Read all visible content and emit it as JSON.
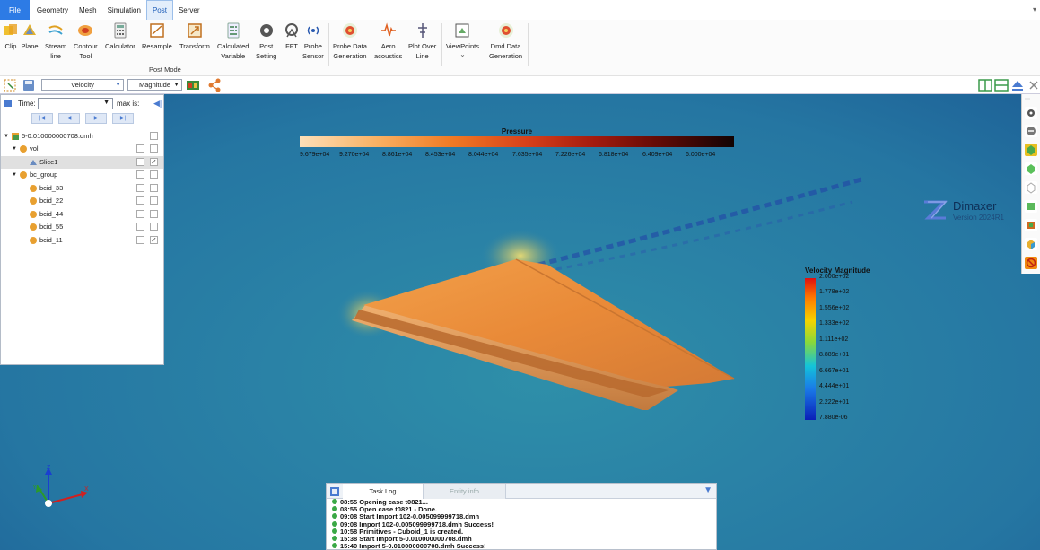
{
  "menu": {
    "items": [
      "File",
      "Geometry",
      "Mesh",
      "Simulation",
      "Post",
      "Server"
    ],
    "active": "Post"
  },
  "ribbon": {
    "buttons": [
      {
        "label": "Clip",
        "icon": "clip-icon"
      },
      {
        "label": "Plane",
        "icon": "plane-icon"
      },
      {
        "label": "Stream\nline",
        "icon": "streamline-icon"
      },
      {
        "label": "Contour\nTool",
        "icon": "contour-icon"
      },
      {
        "label": "Calculator",
        "icon": "calculator-icon"
      },
      {
        "label": "Resample",
        "icon": "resample-icon"
      },
      {
        "label": "Transform",
        "icon": "transform-icon"
      },
      {
        "label": "Calculated\nVariable",
        "icon": "calculated-variable-icon"
      },
      {
        "label": "Post\nSetting",
        "icon": "gear-icon"
      },
      {
        "label": "FFT",
        "icon": "fft-icon"
      },
      {
        "label": "Probe\nSensor",
        "icon": "probe-icon"
      },
      {
        "label": "Probe Data\nGeneration",
        "icon": "probe-data-icon"
      },
      {
        "label": "Aero\nacoustics",
        "icon": "aeroacoustics-icon"
      },
      {
        "label": "Plot Over\nLine",
        "icon": "plot-over-line-icon"
      },
      {
        "label": "ViewPoints",
        "icon": "viewpoints-icon"
      },
      {
        "label": "Dmd Data\nGeneration",
        "icon": "dmd-icon"
      }
    ],
    "group_label": "Post Mode"
  },
  "toolbar": {
    "variable": "Velocity",
    "component": "Magnitude"
  },
  "tree": {
    "time_label": "Time:",
    "time_value": "",
    "max_label": "max is:",
    "nodes": [
      {
        "label": "5-0.010000000708.dmh",
        "checked": false
      },
      {
        "label": "vol",
        "checked": false
      },
      {
        "label": "Slice1",
        "checked": true
      },
      {
        "label": "bc_group",
        "checked": false
      },
      {
        "label": "bcid_33",
        "checked": false
      },
      {
        "label": "bcid_22",
        "checked": false
      },
      {
        "label": "bcid_44",
        "checked": false
      },
      {
        "label": "bcid_55",
        "checked": false
      },
      {
        "label": "bcid_11",
        "checked": true
      }
    ]
  },
  "pressure_bar": {
    "title": "Pressure",
    "ticks": [
      "9.679e+04",
      "9.270e+04",
      "8.861e+04",
      "8.453e+04",
      "8.044e+04",
      "7.635e+04",
      "7.226e+04",
      "6.818e+04",
      "6.409e+04",
      "6.000e+04"
    ]
  },
  "velocity_bar": {
    "title": "Velocity Magnitude",
    "ticks": [
      "2.000e+02",
      "1.778e+02",
      "1.556e+02",
      "1.333e+02",
      "1.111e+02",
      "8.889e+01",
      "6.667e+01",
      "4.444e+01",
      "2.222e+01",
      "7.880e-06"
    ]
  },
  "logo": {
    "name": "Dimaxer",
    "version": "Version 2024R1"
  },
  "log": {
    "tabs": [
      "Task Log",
      "Entity info"
    ],
    "lines": [
      "08:55 Opening case t0821...",
      "08:55 Open case t0821 - Done.",
      "09:08 Start Import 102-0.005099999718.dmh",
      "09:08 Import 102-0.005099999718.dmh Success!",
      "10:58 Primitives - Cuboid_1 is created.",
      "15:38 Start Import 5-0.010000000708.dmh",
      "15:40 Import 5-0.010000000708.dmh Success!"
    ]
  },
  "colors": {
    "accent": "#2d7be5",
    "viewport": "#2a82a6",
    "wing": "#e88a3a"
  }
}
